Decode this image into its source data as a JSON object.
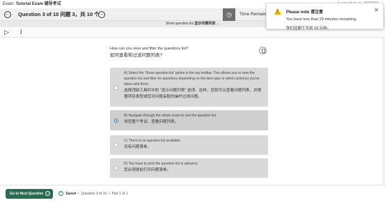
{
  "exam": {
    "prefix": "Exam:",
    "name": "Tutorial Exam 辅导考试",
    "logged_in": "Logged in as"
  },
  "question_bar": {
    "title": "Question 3 of 10 问题 3，共 10 个",
    "time_remaining": "Time Remaining"
  },
  "show_list": {
    "label": "Show question list",
    "label_zh": "显示问题列表",
    "chevron": "⌄"
  },
  "tools": {
    "icon1": "page-select-icon",
    "icon2": "text-cursor-icon"
  },
  "question": {
    "text_en": "How can you view and filter the questions list?",
    "text_zh": "如何查看和过滤问题列表?"
  },
  "options": [
    {
      "letter": "A)",
      "en": "Select the 'Show question list' option in the top toolbar. This allows you to view the question list and filter for questions depending on the item type or which action(s) you've taken with them.",
      "zh": "选择顶部工具栏中的 \"显示问题列表\" 选项。这样，您就可以查看问题列表，并根据项目类型或您对问题采取的操作过滤问题。"
    },
    {
      "letter": "B)",
      "en": "Navigate through the whole exam to see the question list.",
      "zh": "浏览整个考试，查看问题列表。"
    },
    {
      "letter": "C)",
      "en": "There is no question list available.",
      "zh": "没有问题清单。"
    },
    {
      "letter": "D)",
      "en": "You have to print the question list in advance.",
      "zh": "您必须提前打印问题清单。"
    }
  ],
  "selected_option": "B",
  "footer": {
    "next_label": "Go to Next Question",
    "saved": "Saved",
    "question_status": "Question 3 of 10",
    "part": "Part 1 of 1"
  },
  "toast": {
    "title": "Please note 请注意",
    "line_en": "You have less than 29 minutes remaining.",
    "line_zh": "你们还剩下不到 29 分钟。"
  },
  "colors": {
    "accent_green": "#2a6b52",
    "radio_blue": "#2c6fb3",
    "warn_yellow": "#f0b400"
  }
}
